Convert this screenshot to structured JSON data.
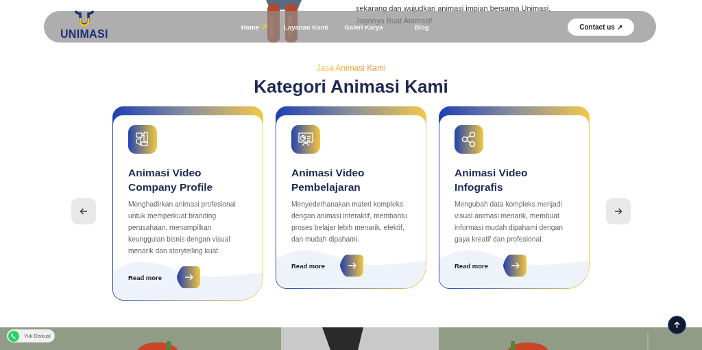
{
  "hero": {
    "lines": [
      "sekarang dan wujudkan animasi impian bersama Unimasi,",
      "Jagonya Buat Animasi!"
    ]
  },
  "header": {
    "logo": "UNIMASI",
    "nav": [
      {
        "label": "Home",
        "selected": true
      },
      {
        "label": "Layanan Kami",
        "selected": false
      },
      {
        "label": "Galeri Karya",
        "selected": false
      },
      {
        "label": "Blog",
        "selected": false
      }
    ],
    "contact": "Contact us ↗"
  },
  "section": {
    "eyebrow": "Jasa Animasi Kami",
    "title": "Kategori Animasi Kami",
    "cards": [
      {
        "title": "Animasi Video Company Profile",
        "text": "Menghadirkan animasi profesional untuk memperkuat branding perusahaan, menampilkan keunggulan bisnis dengan visual menarik dan storytelling kuat.",
        "link": "Read more"
      },
      {
        "title": "Animasi Video Pembelajaran",
        "text": "Menyederhanakan materi kompleks dengan animasi interaktif, membantu proses belajar lebih menarik, efektif, dan mudah dipahami.",
        "link": "Read more"
      },
      {
        "title": "Animasi Video Infografis",
        "text": "Mengubah data kompleks menjadi visual animasi menarik, membuat informasi mudah dipahami dengan gaya kreatif dan profesional.",
        "link": "Read more"
      }
    ]
  },
  "chat": {
    "label": "Yuk Diskusi"
  }
}
